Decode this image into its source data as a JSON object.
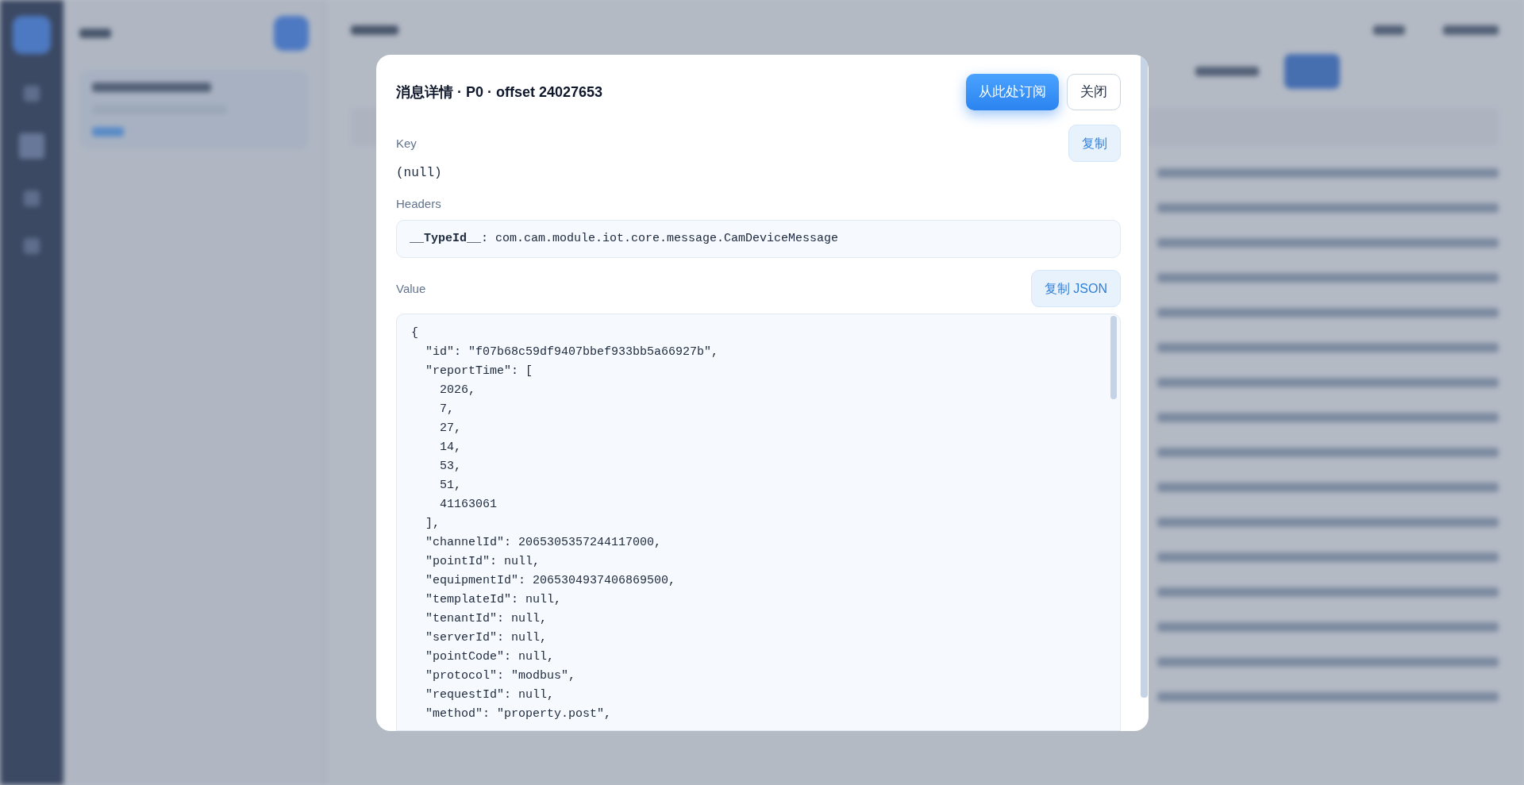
{
  "dialog": {
    "title": "消息详情 · P0 · offset 24027653",
    "buttons": [
      {
        "label": "从此处订阅",
        "kind": "primary"
      },
      {
        "label": "关闭",
        "kind": "secondary"
      }
    ],
    "key": {
      "label": "Key",
      "copy_button": "复制",
      "value": "(null)"
    },
    "headers": {
      "label": "Headers",
      "items": [
        {
          "key": "__TypeId__",
          "separator": ":",
          "value": "com.cam.module.iot.core.message.CamDeviceMessage"
        }
      ]
    },
    "value": {
      "label": "Value",
      "copy_button": "复制 JSON",
      "lines": [
        "{",
        "  \"id\": \"f07b68c59df9407bbef933bb5a66927b\",",
        "  \"reportTime\": [",
        "    2026,",
        "    7,",
        "    27,",
        "    14,",
        "    53,",
        "    51,",
        "    41163061",
        "  ],",
        "  \"channelId\": 2065305357244117000,",
        "  \"pointId\": null,",
        "  \"equipmentId\": 2065304937406869500,",
        "  \"templateId\": null,",
        "  \"tenantId\": null,",
        "  \"serverId\": null,",
        "  \"pointCode\": null,",
        "  \"protocol\": \"modbus\",",
        "  \"requestId\": null,",
        "  \"method\": \"property.post\","
      ]
    }
  }
}
